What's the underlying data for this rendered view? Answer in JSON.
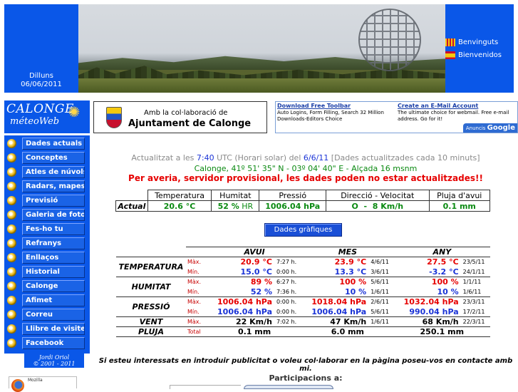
{
  "header": {
    "day": "Dilluns",
    "date": "06/06/2011",
    "languages": [
      {
        "label": "Benvinguts",
        "flag": "catalan-flag-icon"
      },
      {
        "label": "Bienvenidos",
        "flag": "spanish-flag-icon"
      }
    ]
  },
  "logo": {
    "line1": "CALONGE",
    "line2": "méteoWeb"
  },
  "nav": {
    "items": [
      "Dades actuals",
      "Conceptes",
      "Atles de núvols",
      "Radars, mapes...",
      "Previsió",
      "Galeria de fotos",
      "Fes-ho tu",
      "Refranys",
      "Enllaços",
      "Historial",
      "Calonge",
      "Afimet",
      "Correu",
      "Llibre de visites",
      "Facebook"
    ],
    "author_line1": "Jordi Oriol",
    "author_line2": "© 2001 - 2011"
  },
  "collab": {
    "text": "Amb la col·laboració de",
    "org": "Ajuntament de Calonge"
  },
  "ads": [
    {
      "title": "Download Free Toolbar",
      "body": "Auto Logins, Form Filling, Search 32 Million Downloads-Editors Choice"
    },
    {
      "title": "Create an E-Mail Account",
      "body": "The ultimate choice for webmail. Free e-mail address. Go for it!"
    }
  ],
  "ads_label": {
    "prefix": "Anuncis",
    "brand": "Google"
  },
  "status": {
    "prefix": "Actualitzat a les ",
    "time": "7:40",
    "mid": " UTC (Horari solar) del ",
    "date": "6/6/11",
    "suffix": " [Dades actualitzades cada 10 minuts]",
    "coords": "Calonge, 41º 51' 35\" N - 03º 04' 40\" E - Alçada 16 msnm",
    "warning": "Per averia, servidor provisional, les dades poden no estar actualitzades!!"
  },
  "current": {
    "headers": [
      "Temperatura",
      "Humitat",
      "Pressió",
      "Direcció - Velocitat",
      "Pluja d'avui"
    ],
    "row_label": "Actual",
    "temperature": "20.6 °C",
    "humidity_value": "52 %",
    "humidity_unit": " HR",
    "pressure": "1006.04 hPa",
    "direction": "O",
    "speed": "8 Km/h",
    "rain": "0.1 mm"
  },
  "graph_button": "Dades gràfiques",
  "records": {
    "periods": [
      "AVUI",
      "MES",
      "ANY"
    ],
    "max_label": "Màx.",
    "min_label": "Mín.",
    "total_label": "Total",
    "temperature": {
      "label": "TEMPERATURA",
      "max": [
        {
          "v": "20.9",
          "u": "°C",
          "w": "7:27 h."
        },
        {
          "v": "23.9",
          "u": "°C",
          "w": "4/6/11"
        },
        {
          "v": "27.5",
          "u": "°C",
          "w": "23/5/11"
        }
      ],
      "min": [
        {
          "v": "15.0",
          "u": "°C",
          "w": "0:00 h."
        },
        {
          "v": "13.3",
          "u": "°C",
          "w": "3/6/11"
        },
        {
          "v": "-3.2",
          "u": "°C",
          "w": "24/1/11"
        }
      ]
    },
    "humidity": {
      "label": "HUMITAT",
      "max": [
        {
          "v": "89",
          "u": "%",
          "w": "6:27 h."
        },
        {
          "v": "100",
          "u": "%",
          "w": "5/6/11"
        },
        {
          "v": "100",
          "u": "%",
          "w": "1/1/11"
        }
      ],
      "min": [
        {
          "v": "52",
          "u": "%",
          "w": "7:36 h."
        },
        {
          "v": "10",
          "u": "%",
          "w": "1/6/11"
        },
        {
          "v": "10",
          "u": "%",
          "w": "1/6/11"
        }
      ]
    },
    "pressure": {
      "label": "PRESSIÓ",
      "max": [
        {
          "v": "1006.04",
          "u": "hPa",
          "w": "0:00 h."
        },
        {
          "v": "1018.04",
          "u": "hPa",
          "w": "2/6/11"
        },
        {
          "v": "1032.04",
          "u": "hPa",
          "w": "23/3/11"
        }
      ],
      "min": [
        {
          "v": "1006.04",
          "u": "hPa",
          "w": "0:00 h."
        },
        {
          "v": "1006.04",
          "u": "hPa",
          "w": "5/6/11"
        },
        {
          "v": "990.04",
          "u": "hPa",
          "w": "17/2/11"
        }
      ]
    },
    "wind": {
      "label": "VENT",
      "max": [
        {
          "v": "22 Km/h",
          "w": "7:02 h."
        },
        {
          "v": "47 Km/h",
          "w": "1/6/11"
        },
        {
          "v": "68 Km/h",
          "w": "22/3/11"
        }
      ]
    },
    "rain": {
      "label": "PLUJA",
      "total": [
        "0.1 mm",
        "6.0 mm",
        "250.1 mm"
      ]
    }
  },
  "ad_note": "Si esteu interessats en introduir publicitat o voleu col·laborar en la pàgina poseu-vos en contacte amb mi.",
  "participations_label": "Participacions a:",
  "firefox_badge": "Mozilla"
}
